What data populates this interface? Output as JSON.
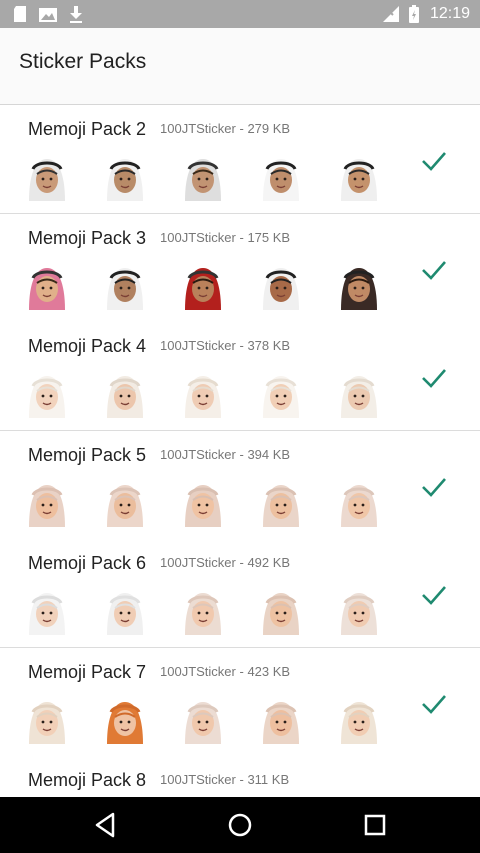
{
  "status_bar": {
    "time": "12:19",
    "icons": [
      "sd-card-icon",
      "photo-icon",
      "download-icon",
      "signal-icon",
      "battery-icon"
    ]
  },
  "app_bar": {
    "title": "Sticker Packs"
  },
  "packs": [
    {
      "name": "Memoji Pack 2",
      "publisher": "100JTSticker",
      "size": "279 KB",
      "stickers": [
        {
          "skin": "#c99a78",
          "cloth": "#e8e8e8",
          "band": "#222",
          "hair": "#333"
        },
        {
          "skin": "#b88b68",
          "cloth": "#f0f0f0",
          "band": "#222",
          "hair": "#2a2a2a"
        },
        {
          "skin": "#c29473",
          "cloth": "#dedede",
          "band": "#333",
          "hair": "#3a2a1a"
        },
        {
          "skin": "#bf8e6c",
          "cloth": "#f5f5f5",
          "band": "#222",
          "hair": "#2a2a2a"
        },
        {
          "skin": "#c4926c",
          "cloth": "#efefef",
          "band": "#222",
          "hair": "#2a2a2a"
        }
      ]
    },
    {
      "name": "Memoji Pack 3",
      "publisher": "100JTSticker",
      "size": "175 KB",
      "stickers": [
        {
          "skin": "#e0b08a",
          "cloth": "#e07a9a",
          "band": "#333",
          "hair": "#3a2a1a"
        },
        {
          "skin": "#b0805f",
          "cloth": "#f0f0f0",
          "band": "#222",
          "hair": "#222"
        },
        {
          "skin": "#b9815b",
          "cloth": "#b3201d",
          "band": "#333",
          "hair": "#2a1a10"
        },
        {
          "skin": "#a86a48",
          "cloth": "#f0f0f0",
          "band": "#222",
          "hair": "#222"
        },
        {
          "skin": "#c08a65",
          "cloth": "#3a2a25",
          "band": "#222",
          "hair": "#2a1a10"
        }
      ]
    },
    {
      "name": "Memoji Pack 4",
      "publisher": "100JTSticker",
      "size": "378 KB",
      "stickers": [
        {
          "skin": "#f2d3bd",
          "cloth": "#f7f3ee",
          "band": "#e7e0d6",
          "hair": "#e7e0d6"
        },
        {
          "skin": "#ecc6ac",
          "cloth": "#f2ebe3",
          "band": "#e0d6ca",
          "hair": "#e0d6ca"
        },
        {
          "skin": "#efccb4",
          "cloth": "#f5efe8",
          "band": "#e6dccf",
          "hair": "#e6dccf"
        },
        {
          "skin": "#f1cfb6",
          "cloth": "#f8f4ef",
          "band": "#e8e0d6",
          "hair": "#e8e0d6"
        },
        {
          "skin": "#eccab1",
          "cloth": "#f3eee7",
          "band": "#e4dbd0",
          "hair": "#e4dbd0"
        }
      ]
    },
    {
      "name": "Memoji Pack 5",
      "publisher": "100JTSticker",
      "size": "394 KB",
      "stickers": [
        {
          "skin": "#eebf9e",
          "cloth": "#e9d2c6",
          "band": "#dcc0b2",
          "hair": "#dcc0b2"
        },
        {
          "skin": "#ebbd9c",
          "cloth": "#ecd6ca",
          "band": "#dcc3b6",
          "hair": "#dcc3b6"
        },
        {
          "skin": "#f0c3a3",
          "cloth": "#e7cfc2",
          "band": "#d9bfb1",
          "hair": "#d9bfb1"
        },
        {
          "skin": "#edc09f",
          "cloth": "#ead5c9",
          "band": "#dbc1b3",
          "hair": "#dbc1b3"
        },
        {
          "skin": "#f0c6a7",
          "cloth": "#ecd9cf",
          "band": "#ddc7bb",
          "hair": "#ddc7bb"
        }
      ]
    },
    {
      "name": "Memoji Pack 6",
      "publisher": "100JTSticker",
      "size": "492 KB",
      "stickers": [
        {
          "skin": "#f1d2bc",
          "cloth": "#f3f3f3",
          "band": "#dcdcdc",
          "hair": "#dcdcdc"
        },
        {
          "skin": "#f0cdb5",
          "cloth": "#f0f0f0",
          "band": "#e0e0e0",
          "hair": "#e0e0e0"
        },
        {
          "skin": "#f1c9ae",
          "cloth": "#ecdcd2",
          "band": "#dec7ba",
          "hair": "#dec7ba"
        },
        {
          "skin": "#eec2a2",
          "cloth": "#e9d3c5",
          "band": "#dcc1b1",
          "hair": "#dcc1b1"
        },
        {
          "skin": "#f0cbb1",
          "cloth": "#ede0d8",
          "band": "#e0cdc1",
          "hair": "#e0cdc1"
        }
      ]
    },
    {
      "name": "Memoji Pack 7",
      "publisher": "100JTSticker",
      "size": "423 KB",
      "stickers": [
        {
          "skin": "#f2d0b8",
          "cloth": "#efe3d5",
          "band": "#e2d1bf",
          "hair": "#e2d1bf"
        },
        {
          "skin": "#efc3a4",
          "cloth": "#e07a35",
          "band": "#d06a2b",
          "hair": "#d06a2b"
        },
        {
          "skin": "#f0c8ac",
          "cloth": "#ecdcd3",
          "band": "#ddc9bd",
          "hair": "#ddc9bd"
        },
        {
          "skin": "#eebf9f",
          "cloth": "#ebd5c7",
          "band": "#dcc2b2",
          "hair": "#dcc2b2"
        },
        {
          "skin": "#f1cdb3",
          "cloth": "#efe4d6",
          "band": "#e2d2c0",
          "hair": "#e2d2c0"
        }
      ]
    },
    {
      "name": "Memoji Pack 8",
      "publisher": "100JTSticker",
      "size": "311 KB",
      "stickers": []
    }
  ],
  "colors": {
    "check": "#1f8a70",
    "status_bar": "#a8a8a8",
    "nav_bar": "#000000"
  },
  "nav": [
    "back-icon",
    "home-icon",
    "recents-icon"
  ]
}
